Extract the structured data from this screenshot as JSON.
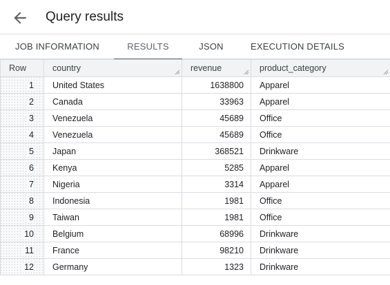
{
  "header": {
    "title": "Query results",
    "back_icon": "arrow-back-icon"
  },
  "tabs": [
    {
      "label": "JOB INFORMATION",
      "active": false
    },
    {
      "label": "RESULTS",
      "active": true
    },
    {
      "label": "JSON",
      "active": false
    },
    {
      "label": "EXECUTION DETAILS",
      "active": false
    }
  ],
  "table": {
    "columns": [
      "Row",
      "country",
      "revenue",
      "product_category"
    ],
    "rows": [
      {
        "row": "1",
        "country": "United States",
        "revenue": "1638800",
        "product_category": "Apparel"
      },
      {
        "row": "2",
        "country": "Canada",
        "revenue": "33963",
        "product_category": "Apparel"
      },
      {
        "row": "3",
        "country": "Venezuela",
        "revenue": "45689",
        "product_category": "Office"
      },
      {
        "row": "4",
        "country": "Venezuela",
        "revenue": "45689",
        "product_category": "Office"
      },
      {
        "row": "5",
        "country": "Japan",
        "revenue": "368521",
        "product_category": "Drinkware"
      },
      {
        "row": "6",
        "country": "Kenya",
        "revenue": "5285",
        "product_category": "Apparel"
      },
      {
        "row": "7",
        "country": "Nigeria",
        "revenue": "3314",
        "product_category": "Apparel"
      },
      {
        "row": "8",
        "country": "Indonesia",
        "revenue": "1981",
        "product_category": "Office"
      },
      {
        "row": "9",
        "country": "Taiwan",
        "revenue": "1981",
        "product_category": "Office"
      },
      {
        "row": "10",
        "country": "Belgium",
        "revenue": "68996",
        "product_category": "Drinkware"
      },
      {
        "row": "11",
        "country": "France",
        "revenue": "98210",
        "product_category": "Drinkware"
      },
      {
        "row": "12",
        "country": "Germany",
        "revenue": "1323",
        "product_category": "Drinkware"
      }
    ]
  }
}
